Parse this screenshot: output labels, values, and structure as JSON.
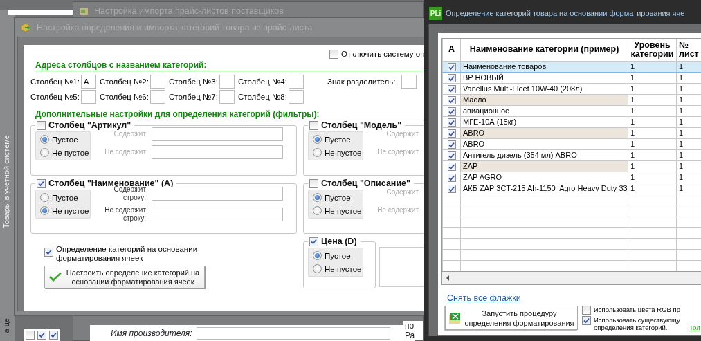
{
  "background_window": {
    "title": "Настройка импорта прайс-листов поставщиков",
    "side_label": "Товары в учетной системе",
    "side_label_lower": "а це",
    "list_checks": [
      false,
      true,
      true
    ],
    "manufacturer_label": "Имя производителя:",
    "edge_texts": [
      "по",
      "Ра"
    ]
  },
  "import_window": {
    "title": "Настройка определения и импорта категорий товара из прайс-листа",
    "disable_option": {
      "label": "Отключить систему оп",
      "checked": false
    },
    "address_heading": "Адреса столбцов с названием категорий:",
    "columns": [
      {
        "label": "Столбец №1:",
        "value": "A"
      },
      {
        "label": "Столбец №2:"
      },
      {
        "label": "Столбец №3:"
      },
      {
        "label": "Столбец №4:"
      },
      {
        "label": "Столбец №5:"
      },
      {
        "label": "Столбец №6:"
      },
      {
        "label": "Столбец №7:"
      },
      {
        "label": "Столбец №8:"
      }
    ],
    "separator_label": "Знак разделитель:",
    "filters_heading": "Дополнительные настройки для определения категорий (фильтры):",
    "filters": [
      {
        "title": "Столбец \"Артикул\"",
        "checked": false,
        "options": [
          {
            "label": "Пустое",
            "selected": true
          },
          {
            "label": "Не пустое",
            "selected": false
          }
        ],
        "fields": [
          "Содержит",
          "Не содержит"
        ]
      },
      {
        "title": "Столбец \"Модель\"",
        "checked": false,
        "options": [
          {
            "label": "Пустое",
            "selected": true
          },
          {
            "label": "Не пустое",
            "selected": false
          }
        ],
        "fields": [
          "Содержит",
          "Не содержит"
        ]
      },
      {
        "title": "Столбец \"Наименование\" (A)",
        "checked": true,
        "options": [
          {
            "label": "Пустое",
            "selected": false
          },
          {
            "label": "Не пустое",
            "selected": true
          }
        ],
        "fields": [
          "Содержит строку:",
          "Не содержит строку:"
        ]
      },
      {
        "title": "Столбец \"Описание\"",
        "checked": false,
        "options": [
          {
            "label": "Пустое",
            "selected": true
          },
          {
            "label": "Не пустое",
            "selected": false
          }
        ],
        "fields": [
          "Содержит",
          "Не содержит"
        ]
      },
      {
        "title": "Цена (D)",
        "checked": true,
        "options": [
          {
            "label": "Пустое",
            "selected": true
          },
          {
            "label": "Не пустое",
            "selected": false
          }
        ]
      }
    ],
    "format_option": {
      "label": "Определение категорий на основании форматирования ячеек",
      "checked": true
    },
    "setup_button": "Настроить определение категорий на основании форматирования ячеек"
  },
  "format_window": {
    "logo_text": "PLi",
    "title": "Определение категорий товара на основании форматирования яче",
    "columns": [
      "A",
      "Наименование категории (пример)",
      "Уровень категории",
      "№ лист"
    ],
    "rows": [
      {
        "checked": true,
        "name": "Наименование товаров",
        "category_level": "1",
        "sheet": "1",
        "selected": true,
        "color": "#d5ecf8"
      },
      {
        "checked": true,
        "name": "BP НОВЫЙ",
        "category_level": "1",
        "sheet": "1",
        "selected": false,
        "color": "#ffffff"
      },
      {
        "checked": true,
        "name": "Vanellus Multi-Fleet 10W-40 (208л)",
        "category_level": "1",
        "sheet": "1",
        "selected": false,
        "color": "#ffffff"
      },
      {
        "checked": true,
        "name": "Масло",
        "category_level": "1",
        "sheet": "1",
        "selected": false,
        "color": "#ebe5dc"
      },
      {
        "checked": true,
        "name": "авиационное",
        "category_level": "1",
        "sheet": "1",
        "selected": false,
        "color": "#ffffff"
      },
      {
        "checked": true,
        "name": "МГЕ-10А (15кг)",
        "category_level": "1",
        "sheet": "1",
        "selected": false,
        "color": "#ffffff"
      },
      {
        "checked": true,
        "name": "ABRO",
        "category_level": "1",
        "sheet": "1",
        "selected": false,
        "color": "#ebe5dc"
      },
      {
        "checked": true,
        "name": "ABRO",
        "category_level": "1",
        "sheet": "1",
        "selected": false,
        "color": "#ffffff"
      },
      {
        "checked": true,
        "name": "Антигель дизель (354 мл) ABRO",
        "category_level": "1",
        "sheet": "1",
        "selected": false,
        "color": "#ffffff"
      },
      {
        "checked": true,
        "name": "ZAP",
        "category_level": "1",
        "sheet": "1",
        "selected": false,
        "color": "#ebe5dc"
      },
      {
        "checked": true,
        "name": "ZAP AGRO",
        "category_level": "1",
        "sheet": "1",
        "selected": false,
        "color": "#ffffff"
      },
      {
        "checked": true,
        "name": "АКБ ZAP 3CT-215 Ah-1150  Agro Heavy Duty 33",
        "category_level": "1",
        "sheet": "1",
        "selected": false,
        "color": "#ffffff"
      }
    ],
    "clear_link": "Снять все флажки",
    "run_button": "Запустить процедуру определения форматирования",
    "options": [
      {
        "label": "Использовать цвета RGB пр",
        "checked": false
      },
      {
        "label": "Использовать существующу определения категорий.",
        "link": "Тол",
        "checked": true
      }
    ]
  }
}
